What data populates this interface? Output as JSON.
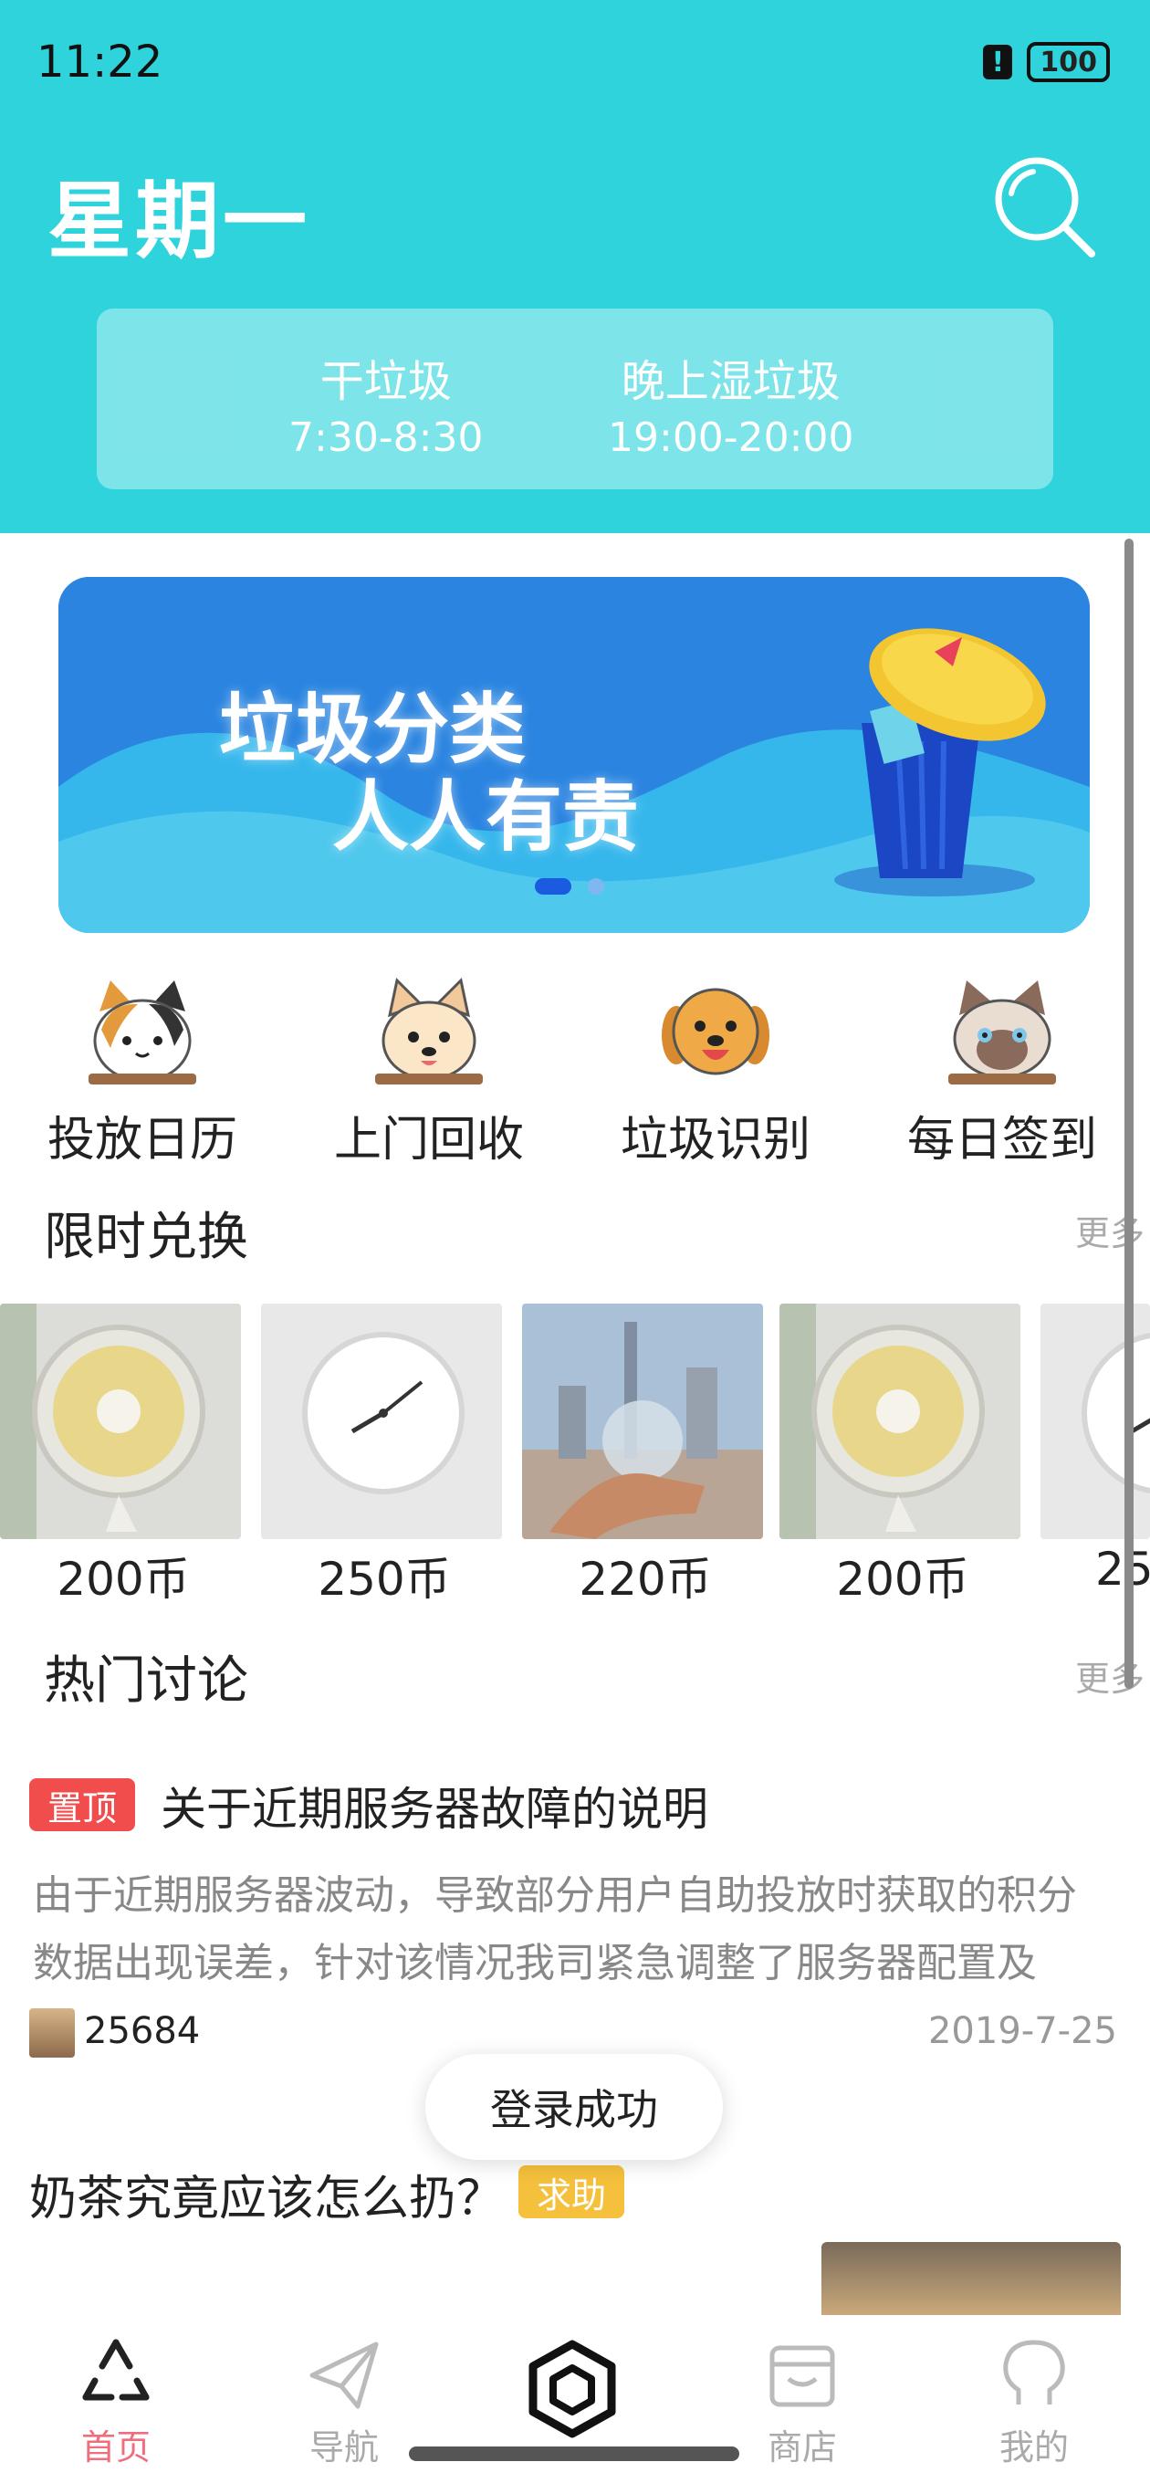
{
  "status_bar": {
    "time": "11:22",
    "battery": "100"
  },
  "header": {
    "day": "星期一",
    "schedule": {
      "dry_label": "干垃圾",
      "dry_time": "7:30-8:30",
      "wet_label": "晚上湿垃圾",
      "wet_time": "19:00-20:00"
    }
  },
  "banner": {
    "line1": "垃圾分类",
    "line2": "人人有责"
  },
  "quick_menu": [
    {
      "label": "投放日历",
      "icon": "calico-cat-icon"
    },
    {
      "label": "上门回收",
      "icon": "shiba-dog-icon"
    },
    {
      "label": "垃圾识别",
      "icon": "golden-dog-icon"
    },
    {
      "label": "每日签到",
      "icon": "siamese-cat-icon"
    }
  ],
  "exchange": {
    "title": "限时兑换",
    "more": "更多",
    "products": [
      {
        "price": "200币",
        "image": "desk-fan"
      },
      {
        "price": "250币",
        "image": "wall-clock"
      },
      {
        "price": "220币",
        "image": "city-glass-ball"
      },
      {
        "price": "200币",
        "image": "desk-fan"
      },
      {
        "price": "25",
        "image": "wall-clock"
      }
    ]
  },
  "discussion": {
    "title": "热门讨论",
    "more": "更多",
    "pinned_badge": "置顶",
    "post1_title": "关于近期服务器故障的说明",
    "post1_body_line1": "由于近期服务器波动，导致部分用户自助投放时获取的积分",
    "post1_body_line2": "数据出现误差，针对该情况我司紧急调整了服务器配置及",
    "post1_user": "25684",
    "post1_date": "2019-7-25",
    "post2_title": "奶茶究竟应该怎么扔？",
    "help_badge": "求助"
  },
  "toast": "登录成功",
  "bottom_nav": [
    {
      "label": "首页",
      "icon": "recycle-icon",
      "active": true
    },
    {
      "label": "导航",
      "icon": "paper-plane-icon",
      "active": false
    },
    {
      "label": "",
      "icon": "hexagon-scan-icon",
      "active": false
    },
    {
      "label": "商店",
      "icon": "store-icon",
      "active": false
    },
    {
      "label": "我的",
      "icon": "profile-icon",
      "active": false
    }
  ],
  "colors": {
    "header_bg": "#2ed3dc",
    "active_tab": "#f06d7c",
    "pin_red": "#f24d4d",
    "help_yellow": "#f5c03c"
  }
}
